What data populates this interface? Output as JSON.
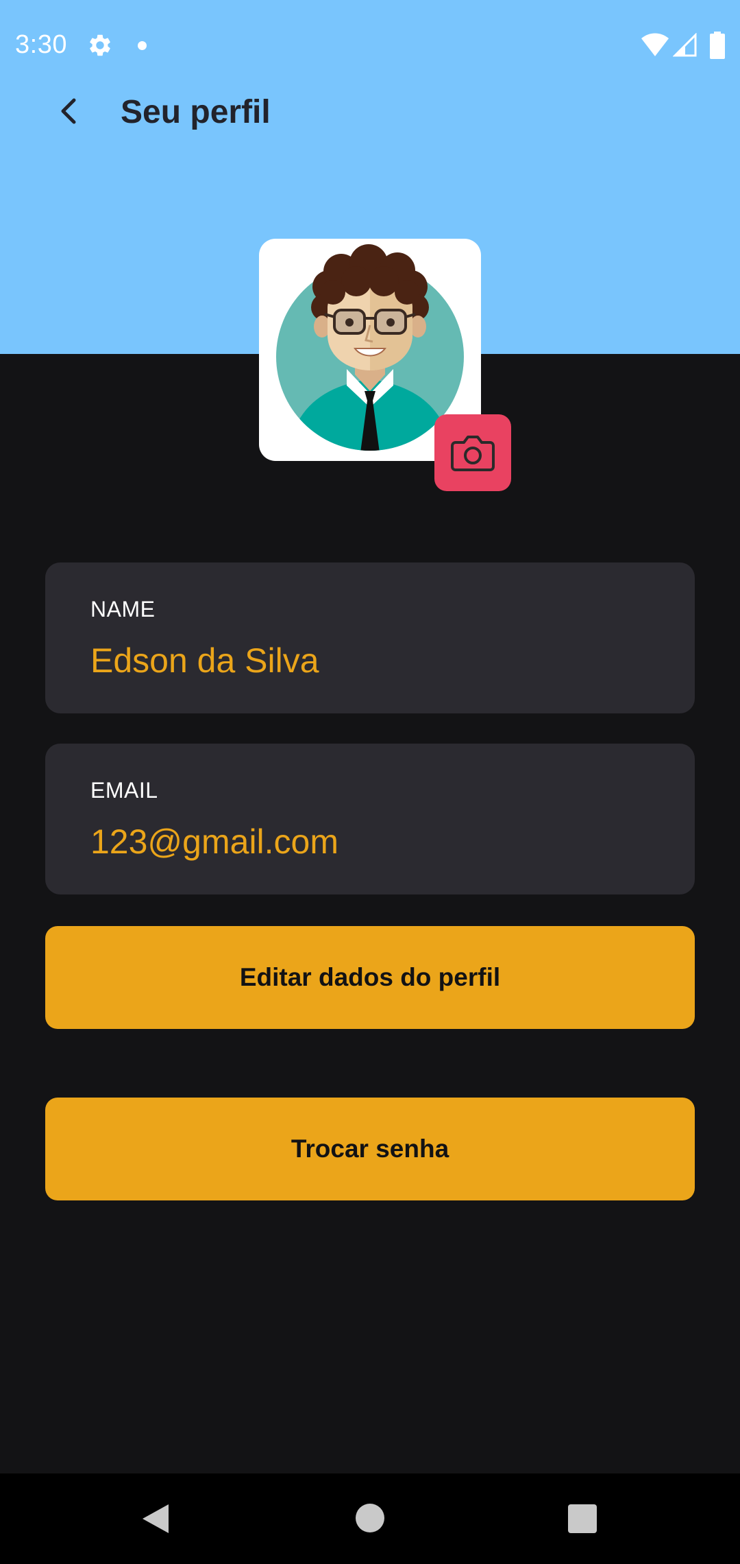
{
  "status_bar": {
    "time": "3:30",
    "icons": [
      "gear-icon",
      "notification-dot-icon",
      "wifi-icon",
      "signal-icon",
      "battery-icon"
    ]
  },
  "app_bar": {
    "title": "Seu perfil",
    "back_icon": "chevron-left-icon"
  },
  "avatar": {
    "camera_icon": "camera-icon"
  },
  "fields": {
    "name": {
      "label": "NAME",
      "value": "Edson da Silva"
    },
    "email": {
      "label": "EMAIL",
      "value": "123@gmail.com"
    }
  },
  "buttons": {
    "edit_profile": "Editar dados do perfil",
    "change_password": "Trocar senha"
  },
  "nav_bar": {
    "icons": [
      "nav-back-icon",
      "nav-home-icon",
      "nav-recents-icon"
    ]
  },
  "colors": {
    "header_blue": "#79c5fd",
    "background": "#131315",
    "field_background": "#2b2a30",
    "accent_orange": "#eba51a",
    "camera_button": "#e94261"
  }
}
